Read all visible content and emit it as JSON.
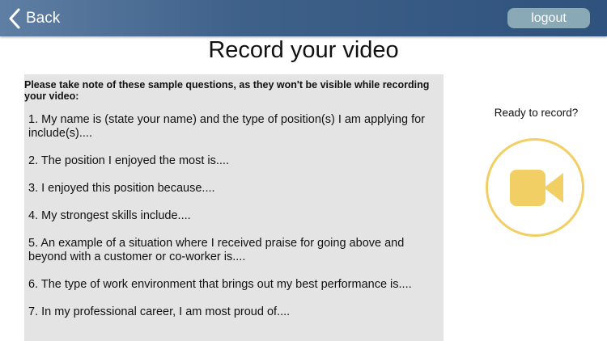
{
  "navbar": {
    "back_label": "Back",
    "logout_label": "logout"
  },
  "page": {
    "title": "Record your video"
  },
  "questions": {
    "notice": "Please take note of these sample questions, as they won't be visible while recording your video:",
    "items": [
      "1. My name is (state your name) and the type of position(s) I am applying for include(s)....",
      "2. The position I enjoyed the most is....",
      "3. I enjoyed this position because....",
      "4. My strongest skills include....",
      "5. An example of a situation where I received praise for going above and beyond with a customer or co-worker is....",
      "6. The type of work environment that brings out my best performance is....",
      "7. In my professional career, I am most proud of...."
    ]
  },
  "record": {
    "prompt": "Ready to record?",
    "icon": "video-camera-icon",
    "accent_color": "#f2cf64"
  },
  "colors": {
    "navbar_start": "#5f7ea3",
    "navbar_end": "#2f527e",
    "logout_bg": "#88a9b5",
    "panel_bg": "#e4e4e4"
  }
}
